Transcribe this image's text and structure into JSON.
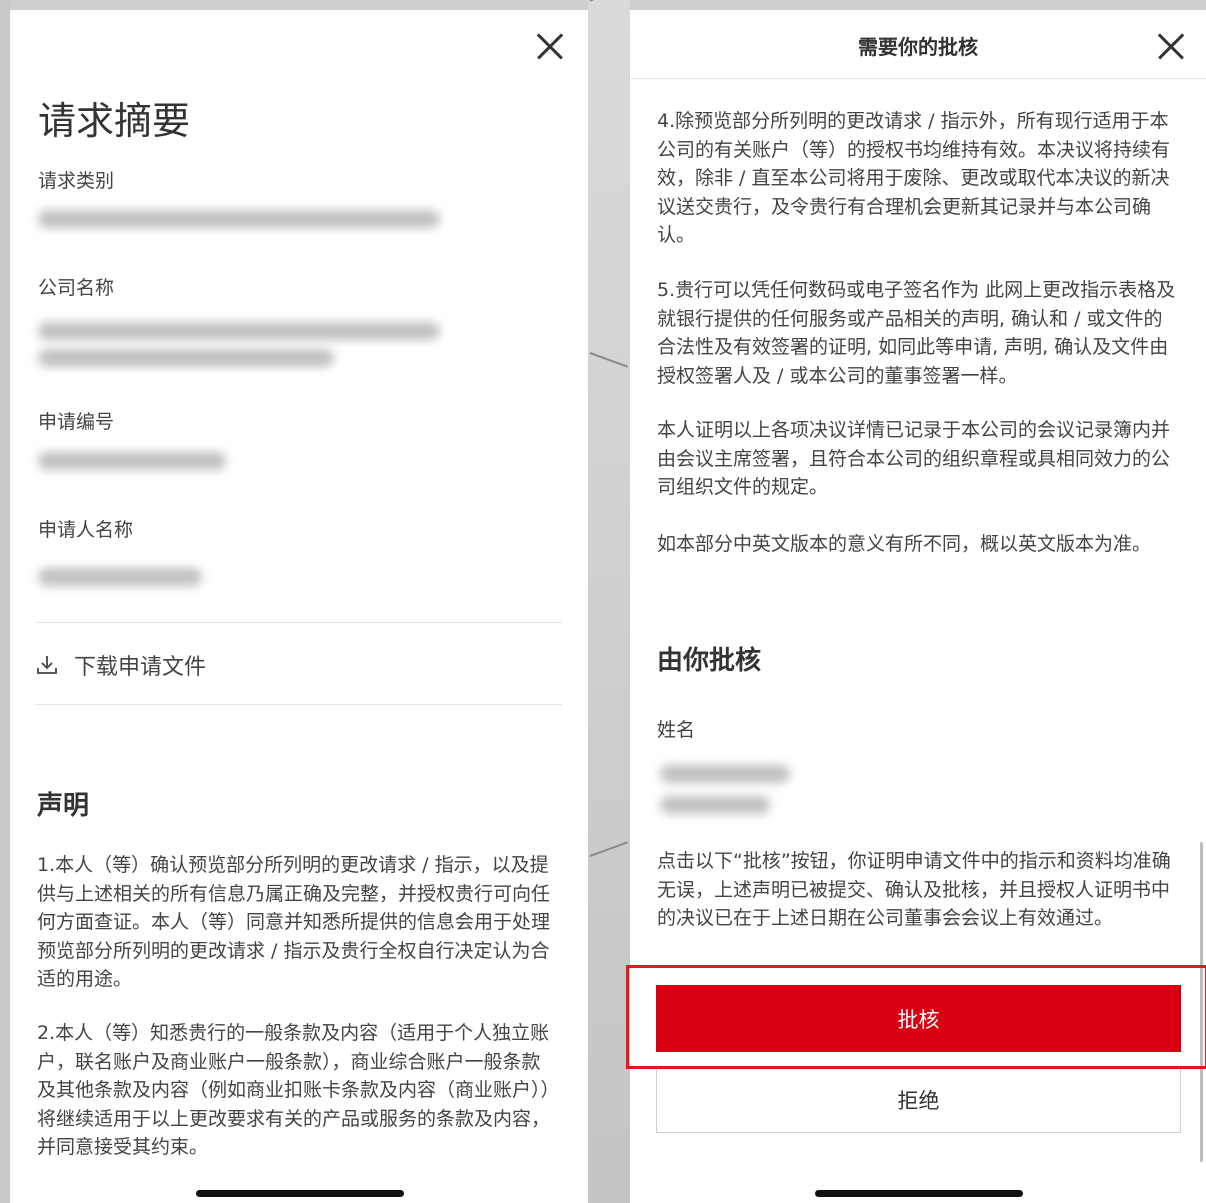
{
  "left": {
    "title": "请求摘要",
    "fields": [
      {
        "label": "请求类别"
      },
      {
        "label": "公司名称"
      },
      {
        "label": "申请编号"
      },
      {
        "label": "申请人名称"
      }
    ],
    "download_label": "下载申请文件",
    "declaration_heading": "声明",
    "paragraphs": [
      "1.本人（等）确认预览部分所列明的更改请求 / 指示，以及提供与上述相关的所有信息乃属正确及完整，并授权贵行可向任何方面查证。本人（等）同意并知悉所提供的信息会用于处理预览部分所列明的更改请求 / 指示及贵行全权自行决定认为合适的用途。",
      "2.本人（等）知悉贵行的一般条款及内容（适用于个人独立账户，联名账户及商业账户一般条款），商业综合账户一般条款及其他条款及内容（例如商业扣账卡条款及内容（商业账户））将继续适用于以上更改要求有关的产品或服务的条款及内容，并同意接受其约束。"
    ]
  },
  "right": {
    "header_title": "需要你的批核",
    "paragraphs": [
      "4.除预览部分所列明的更改请求 / 指示外，所有现行适用于本公司的有关账户（等）的授权书均维持有效。本决议将持续有效，除非 / 直至本公司将用于废除、更改或取代本决议的新决议送交贵行，及令贵行有合理机会更新其记录并与本公司确认。",
      "5.贵行可以凭任何数码或电子签名作为 此网上更改指示表格及就银行提供的任何服务或产品相关的声明, 确认和 / 或文件的合法性及有效签署的证明, 如同此等申请, 声明, 确认及文件由授权签署人及 / 或本公司的董事签署一样。",
      "本人证明以上各项决议详情已记录于本公司的会议记录簿内并由会议主席签署，且符合本公司的组织章程或具相同效力的公司组织文件的规定。",
      "如本部分中英文版本的意义有所不同，概以英文版本为准。"
    ],
    "approve_heading": "由你批核",
    "name_label": "姓名",
    "confirm_text": "点击以下“批核”按钮，你证明申请文件中的指示和资料均准确无误，上述声明已被提交、确认及批核，并且授权人证明书中的决议已在于上述日期在公司董事会会议上有效通过。",
    "approve_button": "批核",
    "reject_button": "拒绝"
  },
  "colors": {
    "accent": "#da0011",
    "highlight": "#e8141e"
  }
}
